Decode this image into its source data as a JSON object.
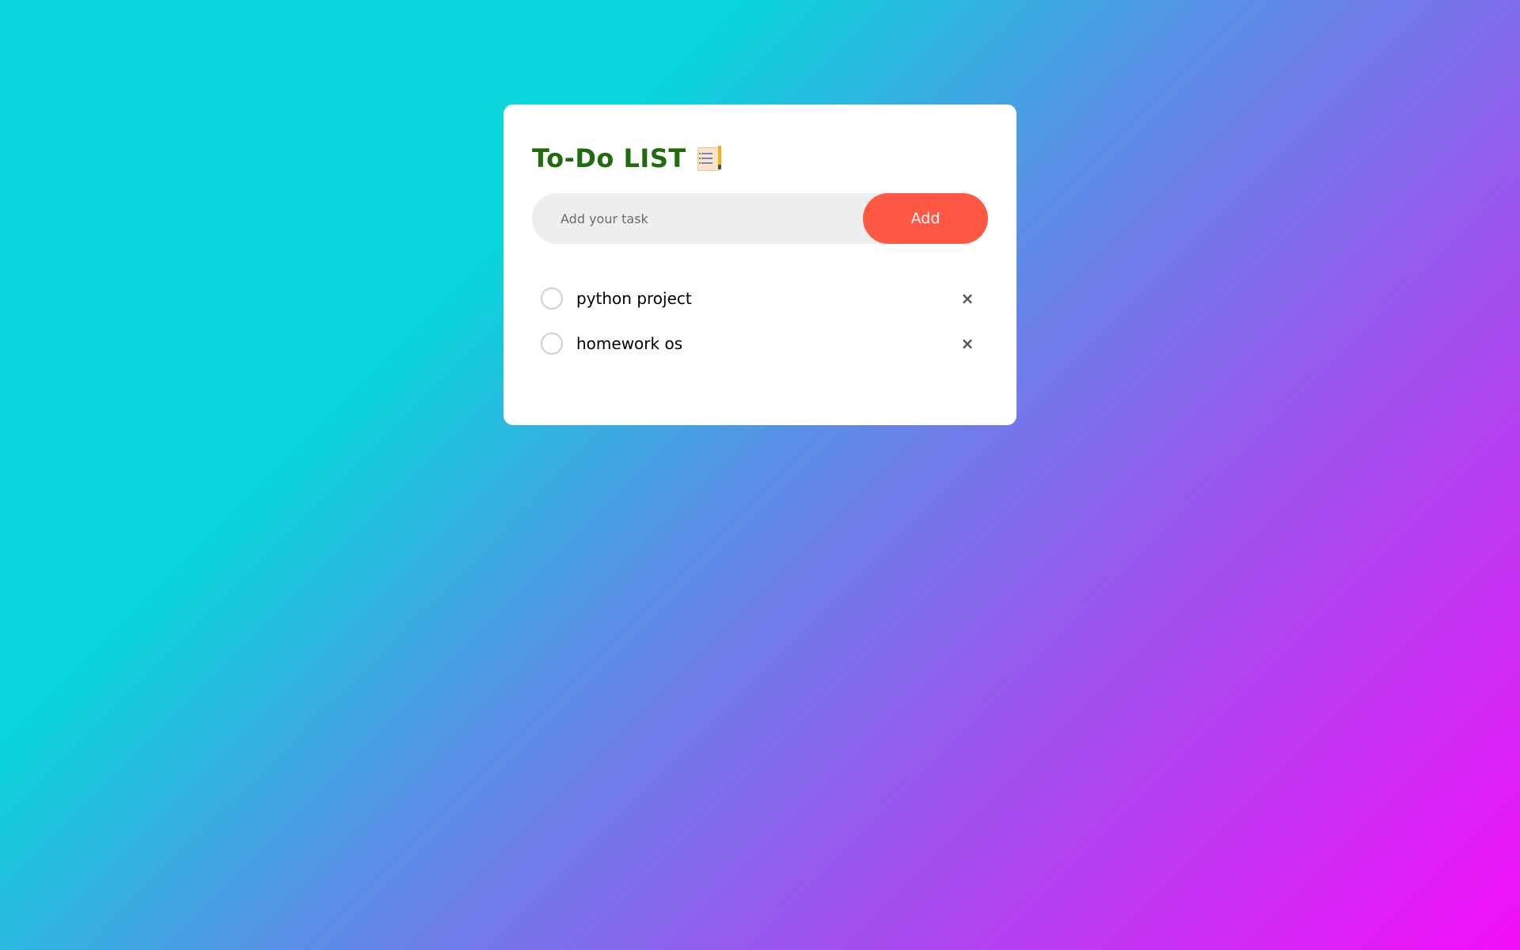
{
  "app": {
    "title": "To-Do LIST",
    "title_icon": "notepad-icon"
  },
  "input": {
    "placeholder": "Add your task",
    "value": ""
  },
  "add_button": {
    "label": "Add"
  },
  "tasks": [
    {
      "text": "python project",
      "checked": false,
      "delete_label": "×"
    },
    {
      "text": "homework os",
      "checked": false,
      "delete_label": "×"
    }
  ],
  "colors": {
    "title": "#1f6b0e",
    "add_button": "#ff5945",
    "input_bg": "#edeef0",
    "gradient_start": "#08d6da",
    "gradient_end": "#f40ef8"
  }
}
